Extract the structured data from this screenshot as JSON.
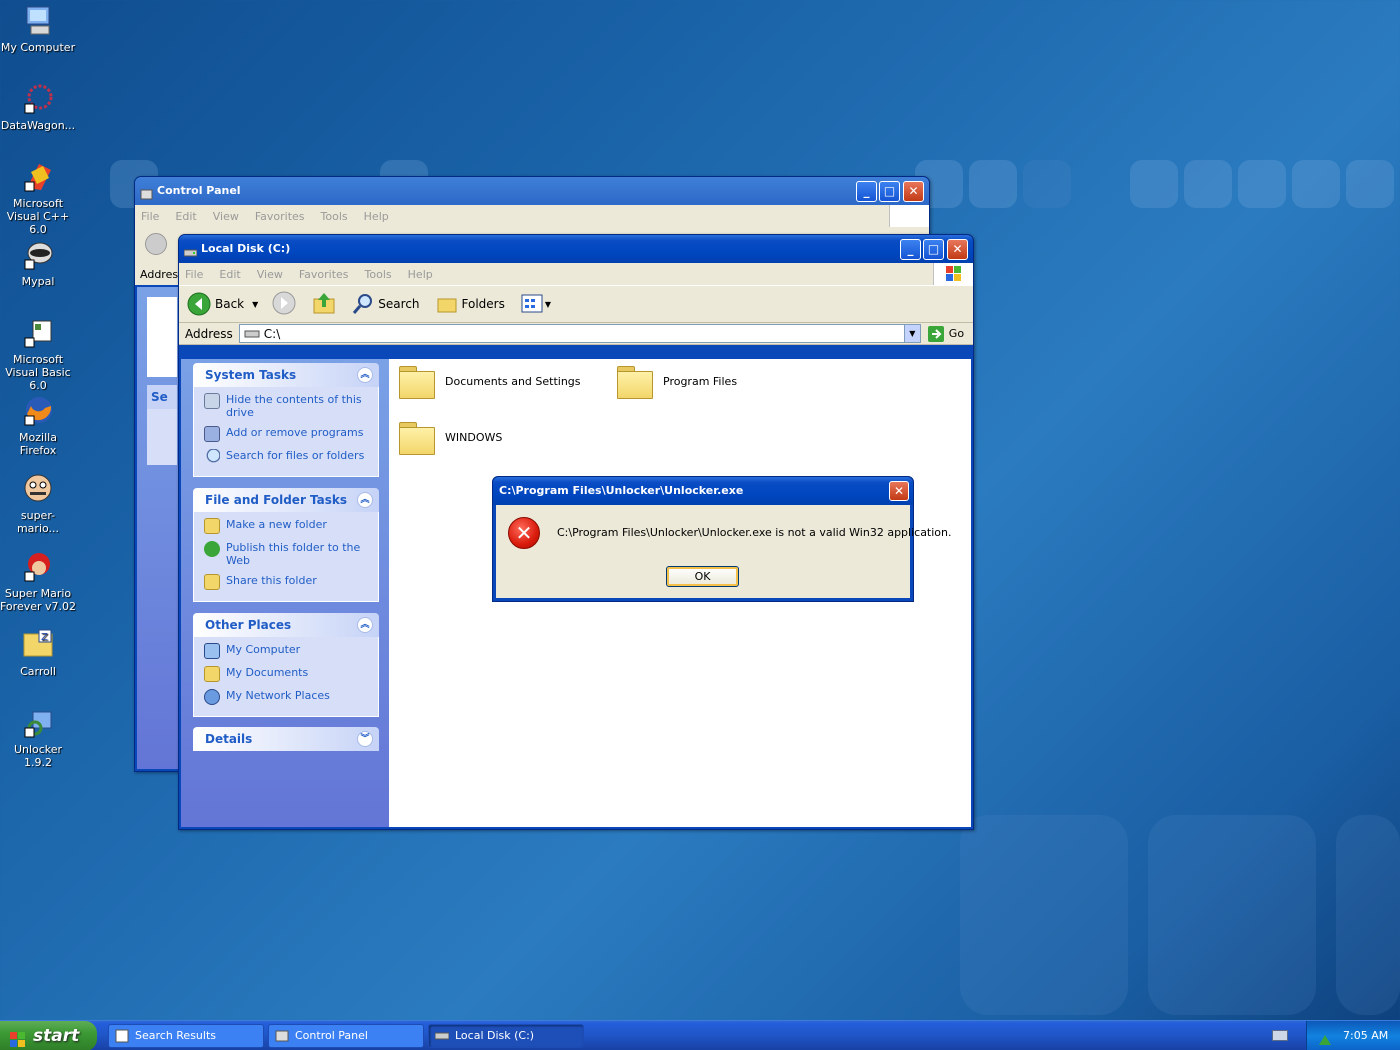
{
  "desktop": {
    "icons": [
      {
        "label": "My Computer",
        "name": "my-computer"
      },
      {
        "label": "DataWagon...",
        "name": "datawagon"
      },
      {
        "label": "Microsoft Visual C++ 6.0",
        "name": "visual-cpp"
      },
      {
        "label": "Mypal",
        "name": "mypal"
      },
      {
        "label": "Microsoft Visual Basic 6.0",
        "name": "visual-basic"
      },
      {
        "label": "Mozilla Firefox",
        "name": "firefox"
      },
      {
        "label": "super-mario...",
        "name": "super-mario"
      },
      {
        "label": "Super Mario Forever v7.02",
        "name": "super-mario-forever"
      },
      {
        "label": "Carroll",
        "name": "carroll"
      },
      {
        "label": "Unlocker 1.9.2",
        "name": "unlocker"
      }
    ]
  },
  "control_panel": {
    "title": "Control Panel",
    "menu": [
      "File",
      "Edit",
      "View",
      "Favorites",
      "Tools",
      "Help"
    ],
    "address_label": "Addres",
    "side_label": "Se"
  },
  "explorer": {
    "title": "Local Disk (C:)",
    "menu": [
      "File",
      "Edit",
      "View",
      "Favorites",
      "Tools",
      "Help"
    ],
    "toolbar": {
      "back": "Back",
      "search": "Search",
      "folders": "Folders"
    },
    "address": {
      "label": "Address",
      "value": "C:\\",
      "go": "Go"
    },
    "system_tasks": {
      "title": "System Tasks",
      "items": [
        "Hide the contents of this drive",
        "Add or remove programs",
        "Search for files or folders"
      ]
    },
    "file_folder_tasks": {
      "title": "File and Folder Tasks",
      "items": [
        "Make a new folder",
        "Publish this folder to the Web",
        "Share this folder"
      ]
    },
    "other_places": {
      "title": "Other Places",
      "items": [
        "My Computer",
        "My Documents",
        "My Network Places"
      ]
    },
    "details": {
      "title": "Details"
    },
    "folders": [
      "Documents and Settings",
      "Program Files",
      "WINDOWS"
    ]
  },
  "dialog": {
    "title": "C:\\Program Files\\Unlocker\\Unlocker.exe",
    "message": "C:\\Program Files\\Unlocker\\Unlocker.exe is not a valid Win32 application.",
    "ok": "OK"
  },
  "taskbar": {
    "start": "start",
    "items": [
      "Search Results",
      "Control Panel",
      "Local Disk (C:)"
    ],
    "clock": "7:05 AM"
  },
  "colors": {
    "title_blue": "#0047c0",
    "taskbar_blue": "#245edb",
    "start_green": "#3c9a35",
    "link_blue": "#215dc6",
    "error_red": "#d91b0c"
  }
}
